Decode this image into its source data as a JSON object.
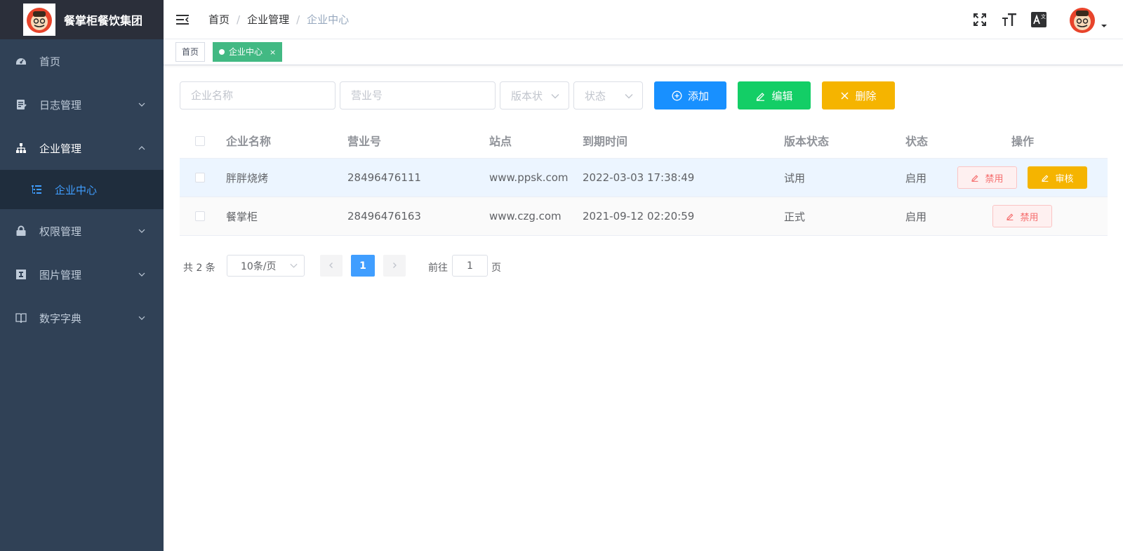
{
  "app": {
    "title": "餐掌柜餐饮集团"
  },
  "sidebar": {
    "items": [
      {
        "label": "首页",
        "icon": "dashboard-icon"
      },
      {
        "label": "日志管理",
        "icon": "log-icon",
        "arrow": "chevron-down"
      },
      {
        "label": "企业管理",
        "icon": "org-tree-icon",
        "arrow": "chevron-up",
        "expanded": true
      },
      {
        "label": "企业中心",
        "icon": "list-tree-icon",
        "active": true
      },
      {
        "label": "权限管理",
        "icon": "lock-icon",
        "arrow": "chevron-down"
      },
      {
        "label": "图片管理",
        "icon": "image-icon",
        "arrow": "chevron-down"
      },
      {
        "label": "数字字典",
        "icon": "book-icon",
        "arrow": "chevron-down"
      }
    ]
  },
  "header": {
    "breadcrumb": [
      "首页",
      "企业管理",
      "企业中心"
    ],
    "icons": [
      "fullscreen-icon",
      "font-size-icon",
      "translate-icon"
    ]
  },
  "tags": [
    {
      "label": "首页",
      "active": false
    },
    {
      "label": "企业中心",
      "active": true,
      "close": "×"
    }
  ],
  "filters": {
    "name_placeholder": "企业名称",
    "license_placeholder": "营业号",
    "version_status_placeholder": "版本状",
    "status_placeholder": "状态"
  },
  "toolbar": {
    "add_label": "添加",
    "edit_label": "编辑",
    "delete_label": "删除"
  },
  "table": {
    "columns": [
      "企业名称",
      "营业号",
      "站点",
      "到期时间",
      "版本状态",
      "状态",
      "操作"
    ],
    "rows": [
      {
        "name": "胖胖烧烤",
        "license": "28496476111",
        "site": "www.ppsk.com",
        "expire": "2022-03-03 17:38:49",
        "version": "试用",
        "status": "启用",
        "actions": [
          "禁用",
          "审核"
        ]
      },
      {
        "name": "餐掌柜",
        "license": "28496476163",
        "site": "www.czg.com",
        "expire": "2021-09-12 02:20:59",
        "version": "正式",
        "status": "启用",
        "actions": [
          "禁用"
        ]
      }
    ]
  },
  "pagination": {
    "total": "共 2 条",
    "page_size": "10条/页",
    "current_page": "1",
    "goto_label": "前往",
    "goto_value": "1",
    "page_suffix": "页"
  },
  "colors": {
    "sidebar": "#304156",
    "logo_bar": "#2b2f3a",
    "primary": "#409eff",
    "add": "#1890ff",
    "edit": "#13ce66",
    "delete": "#f5b400",
    "tag_active": "#42b983"
  }
}
